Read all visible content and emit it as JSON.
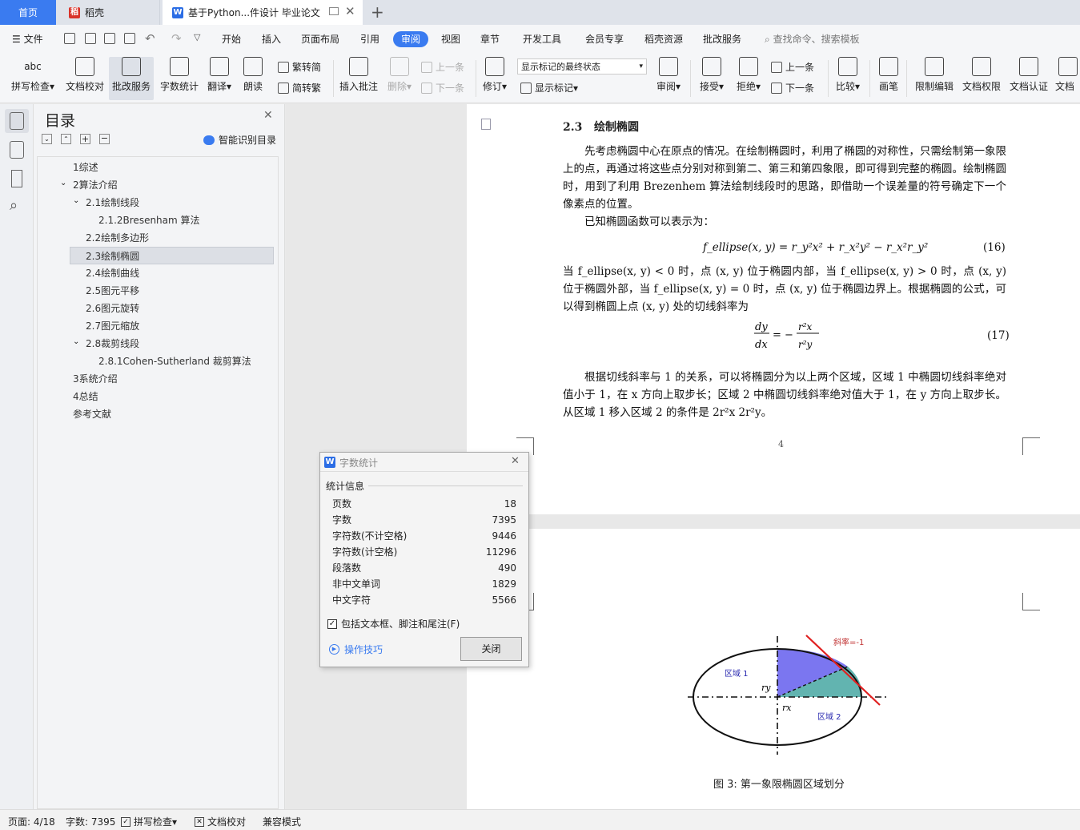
{
  "tabs": {
    "home": "首页",
    "daoke": "稻壳",
    "doc": "基于Python...件设计 毕业论文"
  },
  "menu": {
    "file": "文件",
    "items": [
      "开始",
      "插入",
      "页面布局",
      "引用",
      "审阅",
      "视图",
      "章节",
      "开发工具",
      "会员专享",
      "稻壳资源",
      "批改服务"
    ],
    "active": "审阅",
    "search": "查找命令、搜索模板"
  },
  "ribbon": {
    "spell": "拼写检查",
    "doc_check": "文档校对",
    "review_service": "批改服务",
    "word_count": "字数统计",
    "translate": "翻译",
    "read": "朗读",
    "trad_to_simp": "繁转简",
    "simp_to_trad": "简转繁",
    "insert_comment": "插入批注",
    "delete": "删除",
    "prev": "上一条",
    "next": "下一条",
    "revise": "修订",
    "markup_state": "显示标记的最终状态",
    "show_markup": "显示标记",
    "review": "审阅",
    "accept": "接受",
    "reject": "拒绝",
    "prev2": "上一条",
    "next2": "下一条",
    "compare": "比较",
    "pen": "画笔",
    "restrict_edit": "限制编辑",
    "doc_permission": "文档权限",
    "doc_cert": "文档认证",
    "doc_more": "文档"
  },
  "toc": {
    "title": "目录",
    "smart": "智能识别目录",
    "items": [
      {
        "label": "1综述"
      },
      {
        "label": "2算法介绍"
      },
      {
        "label": "2.1绘制线段"
      },
      {
        "label": "2.1.2Bresenham 算法"
      },
      {
        "label": "2.2绘制多边形"
      },
      {
        "label": "2.3绘制椭圆"
      },
      {
        "label": "2.4绘制曲线"
      },
      {
        "label": "2.5图元平移"
      },
      {
        "label": "2.6图元旋转"
      },
      {
        "label": "2.7图元缩放"
      },
      {
        "label": "2.8裁剪线段"
      },
      {
        "label": "2.8.1Cohen-Sutherland 裁剪算法"
      },
      {
        "label": "3系统介绍"
      },
      {
        "label": "4总结"
      },
      {
        "label": "参考文献"
      }
    ]
  },
  "doc": {
    "heading_num": "2.3",
    "heading": "绘制椭圆",
    "p1": "先考虑椭圆中心在原点的情况。在绘制椭圆时，利用了椭圆的对称性，只需绘制第一象限上的点，再通过将这些点分别对称到第二、第三和第四象限，即可得到完整的椭圆。绘制椭圆时，用到了利用 Brezenhem 算法绘制线段时的思路，即借助一个误差量的符号确定下一个像素点的位置。",
    "p2": "已知椭圆函数可以表示为：",
    "eq16": "f_ellipse(x, y) = r_y²x² + r_x²y² − r_x²r_y²",
    "eq16_num": "(16)",
    "p3": "当 f_ellipse(x, y) < 0 时，点 (x, y) 位于椭圆内部，当 f_ellipse(x, y) > 0 时，点 (x, y) 位于椭圆外部，当 f_ellipse(x, y) = 0 时，点 (x, y) 位于椭圆边界上。根据椭圆的公式，可以得到椭圆上点 (x, y) 处的切线斜率为",
    "eq17_num": "(17)",
    "p4": "根据切线斜率与 1 的关系，可以将椭圆分为以上两个区域，区域 1 中椭圆切线斜率绝对值小于 1，在 x 方向上取步长；区域 2 中椭圆切线斜率绝对值大于 1，在 y 方向上取步长。从区域 1 移入区域 2 的条件是 2r²x 2r²y。",
    "page_num": "4",
    "fig_slope": "斜率=-1",
    "fig_region1": "区域 1",
    "fig_region2": "区域 2",
    "fig_ry": "ry",
    "fig_rx": "rx",
    "caption": "图 3: 第一象限椭圆区域划分"
  },
  "dialog": {
    "title": "字数统计",
    "section": "统计信息",
    "rows": [
      {
        "label": "页数",
        "value": "18"
      },
      {
        "label": "字数",
        "value": "7395"
      },
      {
        "label": "字符数(不计空格)",
        "value": "9446"
      },
      {
        "label": "字符数(计空格)",
        "value": "11296"
      },
      {
        "label": "段落数",
        "value": "490"
      },
      {
        "label": "非中文单词",
        "value": "1829"
      },
      {
        "label": "中文字符",
        "value": "5566"
      }
    ],
    "checkbox": "包括文本框、脚注和尾注(F)",
    "tips": "操作技巧",
    "close": "关闭"
  },
  "status": {
    "page": "页面: 4/18",
    "words": "字数: 7395",
    "spell": "拼写检查",
    "check": "文档校对",
    "compat": "兼容模式"
  },
  "colors": {
    "accent": "#3a7bf0",
    "wps_red": "#d9332a"
  }
}
